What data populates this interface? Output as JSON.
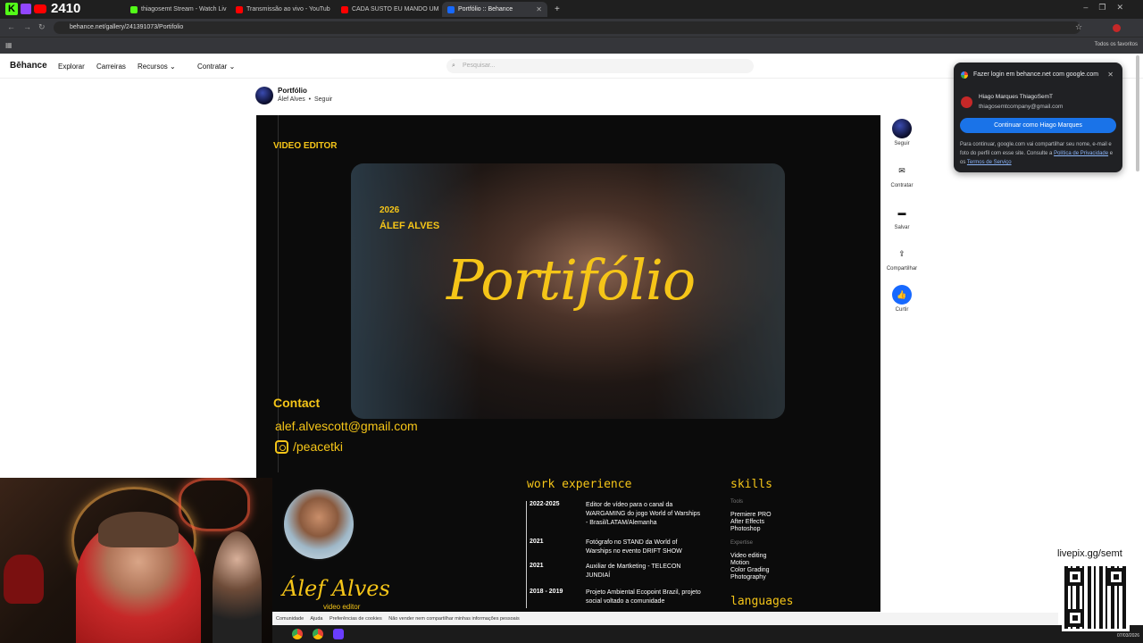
{
  "overlay": {
    "counter": "2410"
  },
  "tabs": [
    {
      "label": "thiagosemt Stream - Watch Liv",
      "color": "#53fc18",
      "active": false
    },
    {
      "label": "Transmissão ao vivo - YouTub",
      "color": "#ff0000",
      "active": false
    },
    {
      "label": "CADA SUSTO EU MANDO UM",
      "color": "#ff0000",
      "active": false
    },
    {
      "label": "Portfólio :: Behance",
      "color": "#1769ff",
      "active": true
    }
  ],
  "browser": {
    "url": "behance.net/gallery/241391073/Portifolio",
    "bookmarks_label": "Todos os favoritos"
  },
  "behance_nav": {
    "logo": "Bēhance",
    "explore": "Explorar",
    "careers": "Carreiras",
    "resources": "Recursos",
    "hire": "Contratar",
    "search_placeholder": "Pesquisar..."
  },
  "project": {
    "title": "Portfólio",
    "author": "Álef Alves",
    "follow": "Seguir"
  },
  "artwork": {
    "role": "VIDEO EDITOR",
    "year": "2026",
    "name": "ÁLEF ALVES",
    "big_title": "Portifólio",
    "contact_heading": "Contact",
    "email": "alef.alvescott@gmail.com",
    "instagram": "/peacetki",
    "profile_name": "Álef Alves",
    "profile_role": "video editor",
    "work_heading": "work experience",
    "work": [
      {
        "years": "2022-2025",
        "desc": "Editor de vídeo para o canal da WARGAMING do jogo World of Warships - Brasil/LATAM/Alemanha"
      },
      {
        "years": "2021",
        "desc": "Fotógrafo no STAND da World of Warships no evento DRIFT SHOW"
      },
      {
        "years": "2021",
        "desc": "Auxiliar de Martketing - TELECON JUNDIAÍ"
      },
      {
        "years": "2018 - 2019",
        "desc": "Projeto Ambiental Ecopoint Brazil, projeto social voltado a comunidade"
      }
    ],
    "skills_heading": "skills",
    "tools_label": "Tools",
    "tools": "Premiere PRO\nAfter Effects\nPhotoshop",
    "expertise_label": "Expertise",
    "expertise": "Video editing\nMotion\nColor Grading\nPhotography",
    "languages_heading": "languages"
  },
  "side_actions": [
    {
      "label": "Seguir",
      "icon": "avatar-icon"
    },
    {
      "label": "Contratar",
      "icon": "mail-icon"
    },
    {
      "label": "Salvar",
      "icon": "folder-icon"
    },
    {
      "label": "Compartilhar",
      "icon": "share-icon"
    },
    {
      "label": "Curtir",
      "icon": "thumbs-up-icon"
    }
  ],
  "google_popup": {
    "header": "Fazer login em behance.net com google.com",
    "name": "Hiago Marques ThiagoSemT",
    "email": "thiagosemtcompany@gmail.com",
    "button": "Continuar como Hiago Marques",
    "text": "Para continuar, google.com vai compartilhar seu nome, e-mail e foto do perfil com esse site. Consulte a",
    "privacy": "Política de Privacidade",
    "and": "e os",
    "terms": "Termos de Serviço"
  },
  "footer": {
    "items": [
      "Comunidade",
      "Ajuda",
      "Preferências de cookies",
      "Não vender nem compartilhar minhas informações pessoais"
    ]
  },
  "livepix": "livepix.gg/semt",
  "clock": "07/03/2026"
}
